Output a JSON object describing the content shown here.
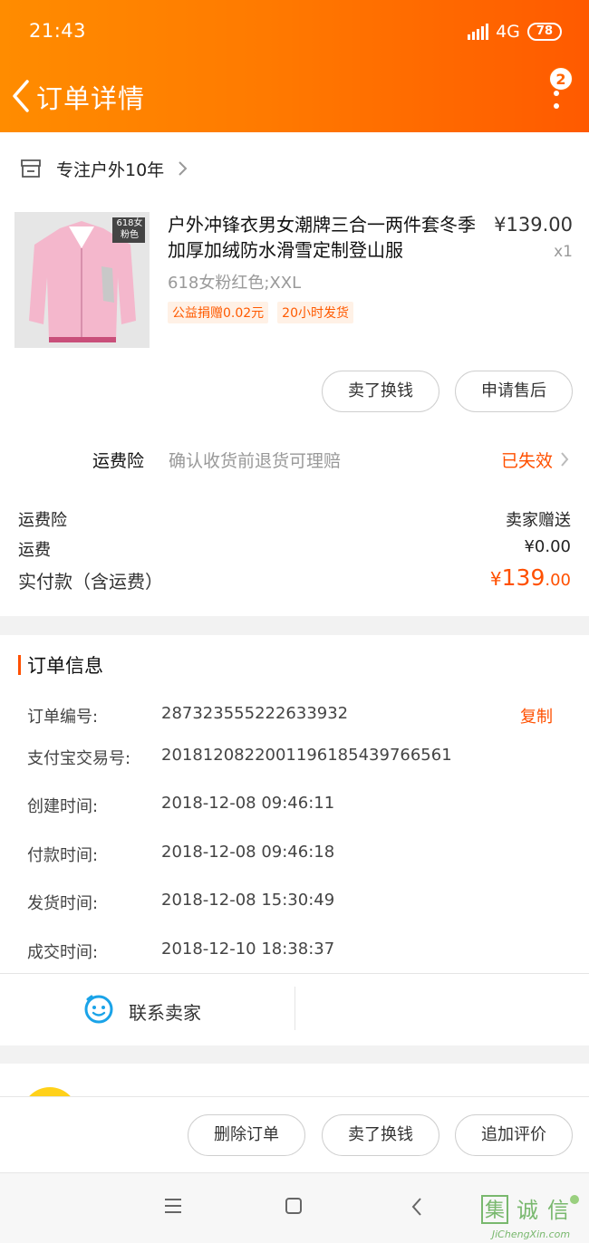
{
  "status": {
    "time": "21:43",
    "network": "4G",
    "battery": "78"
  },
  "header": {
    "title": "订单详情",
    "badge": "2"
  },
  "shop": {
    "name": "专注户外10年"
  },
  "product": {
    "title": "户外冲锋衣男女潮牌三合一两件套冬季加厚加绒防水滑雪定制登山服",
    "price": "¥139.00",
    "qty": "x1",
    "sku": "618女粉红色;XXL",
    "tags": [
      "公益捐赠0.02元",
      "20小时发货"
    ],
    "image_badge": [
      "618女",
      "粉色"
    ]
  },
  "item_actions": {
    "sell": "卖了换钱",
    "after_sale": "申请售后"
  },
  "insurance": {
    "label": "运费险",
    "desc": "确认收货前退货可理赔",
    "status": "已失效"
  },
  "fees": {
    "ins_label": "运费险",
    "ins_value": "卖家赠送",
    "ship_label": "运费",
    "ship_value": "¥0.00",
    "pay_label": "实付款（含运费）",
    "pay_symbol": "¥",
    "pay_int": "139",
    "pay_dec": ".00"
  },
  "order_info": {
    "title": "订单信息",
    "copy": "复制",
    "rows": [
      {
        "k": "订单编号:",
        "v": "287323555222633932"
      },
      {
        "k": "支付宝交易号:",
        "v": "2018120822001196185439766561"
      },
      {
        "k": "创建时间:",
        "v": "2018-12-08 09:46:11"
      },
      {
        "k": "付款时间:",
        "v": "2018-12-08 09:46:18"
      },
      {
        "k": "发货时间:",
        "v": "2018-12-08 15:30:49"
      },
      {
        "k": "成交时间:",
        "v": "2018-12-10 18:38:37"
      }
    ]
  },
  "contact": {
    "label": "联系卖家"
  },
  "bottom_actions": {
    "delete": "删除订单",
    "sell": "卖了换钱",
    "review": "追加评价"
  },
  "watermark": {
    "chars": "集诚信",
    "site": "JiChengXin.com"
  },
  "colors": {
    "accent": "#ff5000",
    "header_start": "#ff8c00",
    "header_end": "#ff5a00"
  }
}
